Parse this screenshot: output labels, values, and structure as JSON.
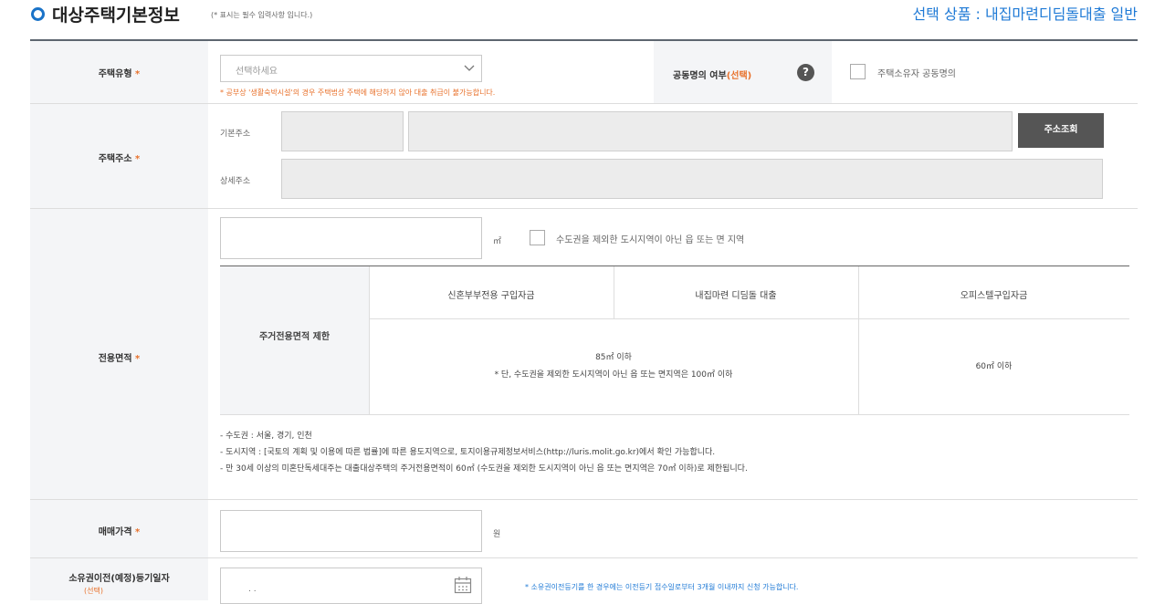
{
  "header": {
    "title": "대상주택기본정보",
    "required_note": "(* 표시는 필수 입력사항 입니다.)",
    "selected_product": "선택 상품 : 내집마련디딤돌대출 일반"
  },
  "house_type": {
    "label": "주택유형",
    "required_mark": "*",
    "select_placeholder": "선택하세요",
    "warning": "* 공부상 '생활숙박시설'의 경우 주택법상 주택에 해당하지 않아 대출 취급이 불가능합니다.",
    "joint_label": "공동명의 여부",
    "joint_optional": "(선택)",
    "help_glyph": "?",
    "joint_checkbox_label": "주택소유자 공동명의"
  },
  "address": {
    "label": "주택주소",
    "required_mark": "*",
    "basic_label": "기본주소",
    "detail_label": "상세주소",
    "search_button": "주소조회"
  },
  "area": {
    "label": "전용면적",
    "required_mark": "*",
    "unit": "㎡",
    "checkbox_label": "수도권을 제외한 도시지역이 아닌 읍 또는 면 지역",
    "table": {
      "row_header": "주거전용면적 제한",
      "columns": [
        "신혼부부전용 구입자금",
        "내집마련 디딤돌 대출",
        "오피스텔구입자금"
      ],
      "merged_value_line1": "85㎡ 이하",
      "merged_value_line2": "* 단, 수도권을 제외한 도시지역이 아닌 읍 또는 면지역은 100㎡ 이하",
      "officetel_value": "60㎡ 이하"
    },
    "notes": [
      "- 수도권 : 서울, 경기, 인천",
      "- 도시지역 : [국토의 계획 및 이용에 따른 법률]에 따른 용도지역으로, 토지이용규제정보서비스(http://luris.molit.go.kr)에서 확인 가능합니다.",
      "- 만 30세 이상의 미혼단독세대주는 대출대상주택의 주거전용면적이 60㎡ (수도권을 제외한 도시지역이 아닌 읍 또는 면지역은 70㎡ 이하)로 제한됩니다."
    ]
  },
  "price": {
    "label": "매매가격",
    "required_mark": "*",
    "unit": "원"
  },
  "transfer": {
    "label": "소유권이전(예정)등기일자",
    "optional": "(선택)",
    "date_placeholder": ". .",
    "note": "* 소유권이전등기를 한 경우에는 이전등기 접수일로부터 3개월 이내까지 신청 가능합니다."
  }
}
